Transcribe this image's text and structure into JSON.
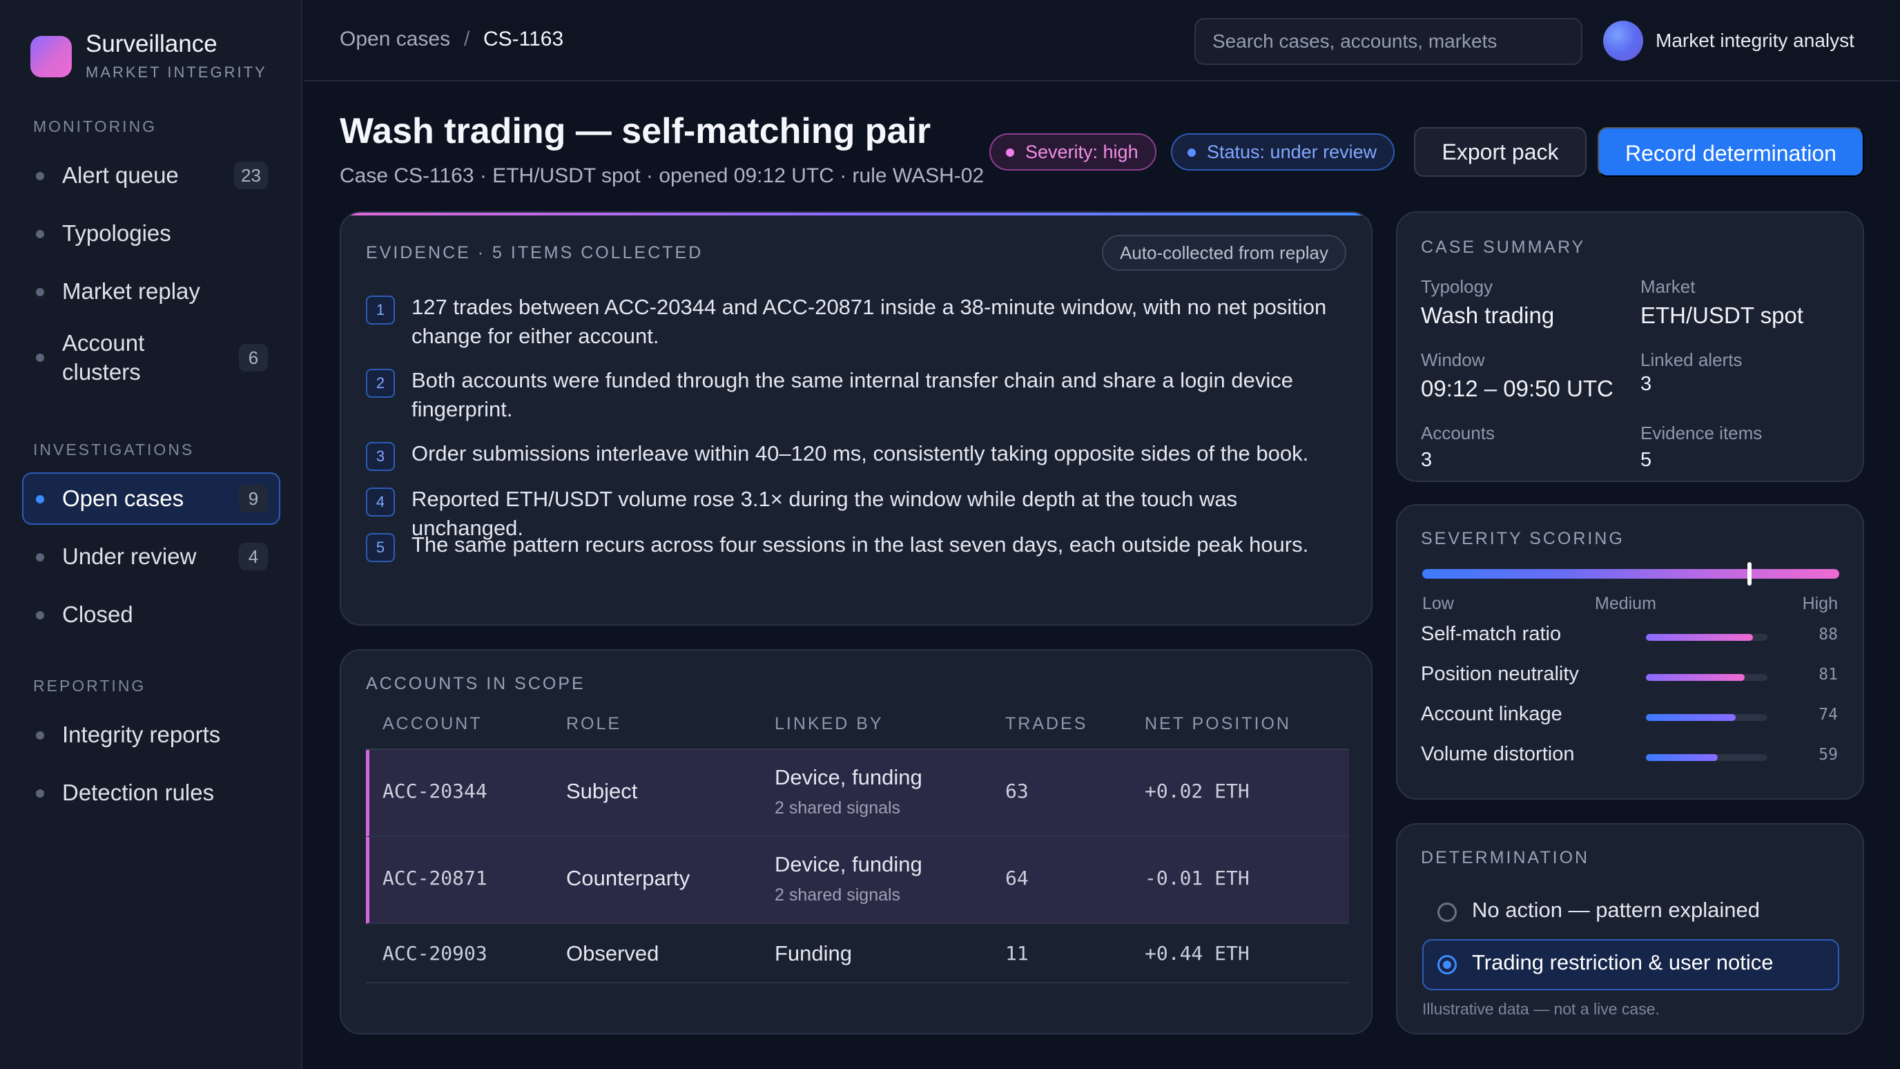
{
  "brand": {
    "name": "Surveillance",
    "subtitle": "MARKET INTEGRITY"
  },
  "sidebar": {
    "sections": [
      {
        "title": "MONITORING"
      },
      {
        "title": "INVESTIGATIONS"
      },
      {
        "title": "REPORTING"
      }
    ],
    "items": [
      {
        "label": "Alert queue",
        "count": "23"
      },
      {
        "label": "Typologies",
        "count": ""
      },
      {
        "label": "Market replay",
        "count": ""
      },
      {
        "label": "Account\nclusters",
        "count": "6"
      },
      {
        "label": "Open cases",
        "count": "9",
        "active": true
      },
      {
        "label": "Under review",
        "count": "4"
      },
      {
        "label": "Closed",
        "count": ""
      },
      {
        "label": "Integrity reports",
        "count": ""
      },
      {
        "label": "Detection rules",
        "count": ""
      }
    ]
  },
  "topbar": {
    "breadcrumb_root": "Open cases",
    "breadcrumb_sep": "/",
    "breadcrumb_current": "CS-1163",
    "search_placeholder": "Search cases, accounts, markets",
    "user_name": "Market integrity analyst"
  },
  "header": {
    "title": "Wash trading — self-matching pair",
    "subtitle": "Case CS-1163 · ETH/USDT spot · opened 09:12 UTC · rule WASH-02",
    "severity_pill": "Severity: high",
    "status_pill": "Status: under review",
    "export_label": "Export pack",
    "record_label": "Record determination"
  },
  "evidence": {
    "title": "EVIDENCE · 5 ITEMS COLLECTED",
    "tag": "Auto-collected from replay",
    "items": [
      {
        "num": "1",
        "text": "127 trades between ACC-20344 and ACC-20871 inside a 38-minute window, with no net position change for either account."
      },
      {
        "num": "2",
        "text": "Both accounts were funded through the same internal transfer chain and share a login device fingerprint."
      },
      {
        "num": "3",
        "text": "Order submissions interleave within 40–120 ms, consistently taking opposite sides of the book."
      },
      {
        "num": "4",
        "text": "Reported ETH/USDT volume rose 3.1× during the window while depth at the touch was unchanged."
      },
      {
        "num": "5",
        "text": "The same pattern recurs across four sessions in the last seven days, each outside peak hours."
      }
    ]
  },
  "accounts": {
    "title": "ACCOUNTS IN SCOPE",
    "columns": [
      "ACCOUNT",
      "ROLE",
      "LINKED BY",
      "TRADES",
      "NET POSITION"
    ],
    "rows": [
      {
        "account": "ACC-20344",
        "role": "Subject",
        "linked_by": "Device, funding",
        "linked_sub": "2 shared signals",
        "trades": "63",
        "net": "+0.02 ETH"
      },
      {
        "account": "ACC-20871",
        "role": "Counterparty",
        "linked_by": "Device, funding",
        "linked_sub": "2 shared signals",
        "trades": "64",
        "net": "-0.01 ETH"
      },
      {
        "account": "ACC-20903",
        "role": "Observed",
        "linked_by": "Funding",
        "linked_sub": "",
        "trades": "11",
        "net": "+0.44 ETH"
      }
    ]
  },
  "summary": {
    "title": "CASE SUMMARY",
    "fields": [
      {
        "label": "Typology",
        "value": "Wash trading"
      },
      {
        "label": "Market",
        "value": "ETH/USDT spot"
      },
      {
        "label": "Window",
        "value": "09:12 – 09:50 UTC"
      },
      {
        "label": "Linked alerts",
        "value": "3"
      },
      {
        "label": "Accounts",
        "value": "3"
      },
      {
        "label": "Evidence items",
        "value": "5"
      }
    ]
  },
  "severity": {
    "title": "SEVERITY SCORING",
    "overall_fraction": 0.785,
    "scale": [
      "Low",
      "Medium",
      "High"
    ],
    "metrics": [
      {
        "label": "Self-match ratio",
        "value": 88
      },
      {
        "label": "Position neutrality",
        "value": 81
      },
      {
        "label": "Account linkage",
        "value": 74
      },
      {
        "label": "Volume distortion",
        "value": 59
      }
    ],
    "colors": {
      "start": "#3d7bff",
      "mid": "#8a6bff",
      "end": "#f06ad2"
    }
  },
  "determination": {
    "title": "DETERMINATION",
    "options": [
      {
        "label": "No action — pattern explained",
        "selected": false
      },
      {
        "label": "Trading restriction & user notice",
        "selected": true
      }
    ],
    "footnote": "Illustrative data — not a live case."
  }
}
